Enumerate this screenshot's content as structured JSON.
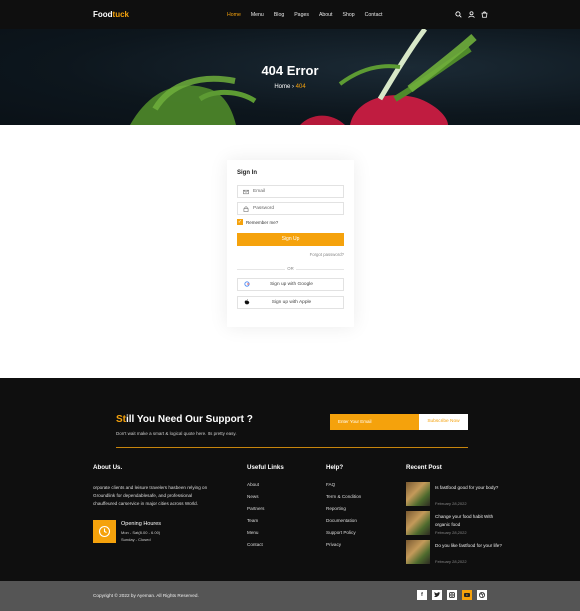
{
  "header": {
    "logo_main": "Food",
    "logo_accent": "tuck",
    "nav": [
      "Home",
      "Menu",
      "Blog",
      "Pages",
      "About",
      "Shop",
      "Contact"
    ],
    "active_nav": "Home",
    "icons": [
      "search-icon",
      "user-icon",
      "cart-icon"
    ]
  },
  "hero": {
    "title": "404 Error",
    "crumb_home": "Home",
    "crumb_sep": "›",
    "crumb_current": "404"
  },
  "signin": {
    "title": "Sign In",
    "email_placeholder": "Email",
    "password_placeholder": "Password",
    "remember": "Remember me?",
    "button": "Sign Up",
    "forgot": "Forgot password?",
    "or": "OR",
    "google": "Sign up with Google",
    "apple": "Sign up with Apple"
  },
  "footer": {
    "support_accent": "St",
    "support_rest": "ill You Need Our Support ?",
    "support_sub": "Don't wait make a smart & logical quote here. Its pretty easy.",
    "subscribe_placeholder": "Enter Your Email",
    "subscribe_button": "Subscribe Now",
    "about_title": "About Us.",
    "about_text": "orporate clients and leisure travelers hasbeen relying on Groundlink for dependablesafe, and professional chauffeured carservice in major cities across World.",
    "opening_title": "Opening Houres",
    "opening_line1": "Mon - Sat(8.00 - 6.00)",
    "opening_line2": "Sunday - Closed",
    "useful_title": "Useful Links",
    "useful_links": [
      "About",
      "News",
      "Partners",
      "Team",
      "Menu",
      "Contact"
    ],
    "help_title": "Help?",
    "help_links": [
      "FAQ",
      "Term & Condition",
      "Reporting",
      "Documentation",
      "Support Policy",
      "Privacy"
    ],
    "recent_title": "Recent Post",
    "posts": [
      {
        "title": "Is fastfood good for your body?",
        "date": "February 28,2022"
      },
      {
        "title": "Change your food habit With organic food",
        "date": "February 28,2022"
      },
      {
        "title": "Do you like fastfood for your life?",
        "date": "February 28,2022"
      }
    ]
  },
  "bottom": {
    "copyright": "Copyright © 2022 by Ayeman. All Rights Reserved.",
    "socials": [
      "f",
      "t",
      "ig",
      "yt",
      "dr"
    ]
  },
  "colors": {
    "accent": "#f5a20c",
    "dark": "#0f0f0f",
    "bottom": "#555555"
  }
}
